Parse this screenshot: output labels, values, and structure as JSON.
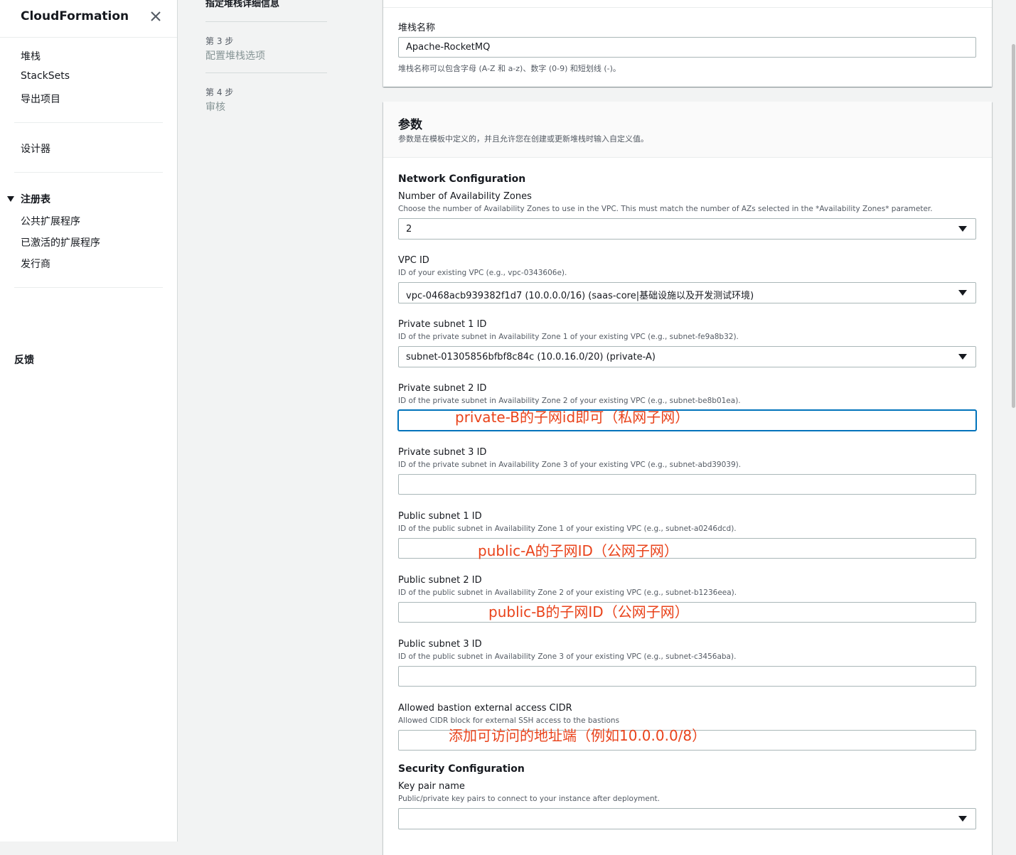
{
  "sidebar": {
    "title": "CloudFormation",
    "items": [
      {
        "label": "堆栈"
      },
      {
        "label": "StackSets"
      },
      {
        "label": "导出项目"
      }
    ],
    "designer": "设计器",
    "registry": {
      "label": "注册表",
      "items": [
        {
          "label": "公共扩展程序"
        },
        {
          "label": "已激活的扩展程序"
        },
        {
          "label": "发行商"
        }
      ]
    },
    "feedback": "反馈"
  },
  "steps": {
    "current": "指定堆栈详细信息",
    "step3": {
      "num": "第 3 步",
      "label": "配置堆栈选项"
    },
    "step4": {
      "num": "第 4 步",
      "label": "审核"
    }
  },
  "stack_name": {
    "label": "堆栈名称",
    "value": "Apache-RocketMQ",
    "hint": "堆栈名称可以包含字母 (A-Z 和 a-z)、数字 (0-9) 和短划线 (-)。"
  },
  "params": {
    "title": "参数",
    "desc": "参数是在模板中定义的，并且允许您在创建或更新堆栈时输入自定义值。",
    "network_section": "Network Configuration",
    "security_section": "Security Configuration",
    "fields": {
      "az": {
        "label": "Number of Availability Zones",
        "desc": "Choose the number of Availability Zones to use in the VPC. This must match the number of AZs selected in the *Availability Zones* parameter.",
        "value": "2"
      },
      "vpc": {
        "label": "VPC ID",
        "desc": "ID of your existing VPC (e.g., vpc-0343606e).",
        "value": "vpc-0468acb939382f1d7 (10.0.0.0/16) (saas-core|基础设施以及开发测试环境)"
      },
      "priv1": {
        "label": "Private subnet 1 ID",
        "desc": "ID of the private subnet in Availability Zone 1 of your existing VPC (e.g., subnet-fe9a8b32).",
        "value": "subnet-01305856bfbf8c84c (10.0.16.0/20) (private-A)"
      },
      "priv2": {
        "label": "Private subnet 2 ID",
        "desc": "ID of the private subnet in Availability Zone 2 of your existing VPC (e.g., subnet-be8b01ea).",
        "value": ""
      },
      "priv3": {
        "label": "Private subnet 3 ID",
        "desc": "ID of the private subnet in Availability Zone 3 of your existing VPC (e.g., subnet-abd39039).",
        "value": ""
      },
      "pub1": {
        "label": "Public subnet 1 ID",
        "desc": "ID of the public subnet in Availability Zone 1 of your existing VPC (e.g., subnet-a0246dcd).",
        "value": ""
      },
      "pub2": {
        "label": "Public subnet 2 ID",
        "desc": "ID of the public subnet in Availability Zone 2 of your existing VPC (e.g., subnet-b1236eea).",
        "value": ""
      },
      "pub3": {
        "label": "Public subnet 3 ID",
        "desc": "ID of the public subnet in Availability Zone 3 of your existing VPC (e.g., subnet-c3456aba).",
        "value": ""
      },
      "cidr": {
        "label": "Allowed bastion external access CIDR",
        "desc": "Allowed CIDR block for external SSH access to the bastions",
        "value": ""
      },
      "key": {
        "label": "Key pair name",
        "desc": "Public/private key pairs to connect to your instance after deployment.",
        "value": ""
      }
    }
  },
  "annotations": {
    "priv2": "private-B的子网id即可（私网子网）",
    "pub1": "public-A的子网ID（公网子网）",
    "pub2": "public-B的子网ID（公网子网）",
    "cidr": "添加可访问的地址端（例如10.0.0.0/8）"
  },
  "colors": {
    "annotation": "#e9431b",
    "focus": "#0073bb",
    "background": "#f2f3f3"
  }
}
